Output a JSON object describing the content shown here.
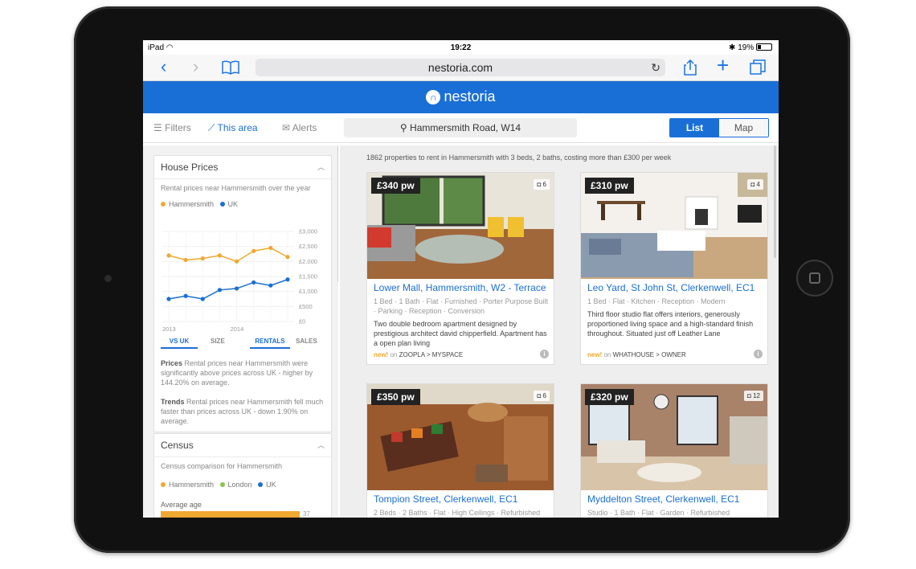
{
  "status_bar": {
    "carrier": "iPad",
    "time": "19:22",
    "battery": "19%"
  },
  "browser": {
    "url": "nestoria.com"
  },
  "site": {
    "logo_text": "nestoria",
    "brand_color": "#1a6fd6"
  },
  "toolbar": {
    "filters": "Filters",
    "this_area": "This area",
    "alerts": "Alerts",
    "search_value": "Hammersmith Road, W14",
    "list": "List",
    "map": "Map"
  },
  "sidebar": {
    "house_prices": {
      "title": "House Prices",
      "subtitle": "Rental prices near Hammersmith over the year",
      "legend": [
        "Hammersmith",
        "UK"
      ],
      "tabs": [
        "VS UK",
        "SIZE",
        "RENTALS",
        "SALES"
      ],
      "prices_label": "Prices",
      "prices_text": "Rental prices near Hammersmith were significantly above prices across UK - higher by 144.20% on average.",
      "trends_label": "Trends",
      "trends_text": "Rental prices near Hammersmith fell much faster than prices across UK - down 1.90% on average."
    },
    "census": {
      "title": "Census",
      "subtitle": "Census comparison for Hammersmith",
      "legend": [
        "Hammersmith",
        "London",
        "UK"
      ],
      "average_age_label": "Average age",
      "average_age_value": "37"
    }
  },
  "chart_data": {
    "type": "line",
    "x": [
      "2013-Q1",
      "2013-Q2",
      "2013-Q3",
      "2013-Q4",
      "2014-Q1",
      "2014-Q2",
      "2014-Q3",
      "2014-Q4"
    ],
    "xticks": [
      "2013",
      "2014"
    ],
    "series": [
      {
        "name": "Hammersmith",
        "color": "#f0a830",
        "values": [
          2200,
          2050,
          2100,
          2200,
          2000,
          2350,
          2450,
          2150
        ]
      },
      {
        "name": "UK",
        "color": "#1a6fd6",
        "values": [
          750,
          850,
          750,
          1050,
          1100,
          1300,
          1200,
          1400
        ]
      }
    ],
    "yticks": [
      "£3,000",
      "£2,500",
      "£2,000",
      "£1,500",
      "£1,000",
      "£500",
      "£0"
    ],
    "ylim": [
      0,
      3000
    ],
    "grid": true
  },
  "results": {
    "summary": "1862 properties to rent in Hammersmith with 3 beds, 2 baths, costing more than £300 per week",
    "listings": [
      {
        "price": "£340 pw",
        "photos": "6",
        "title": "Lower Mall, Hammersmith, W2 - Terrace",
        "tags": "1 Bed · 1 Bath · Flat · Furnished · Porter Purpose Built · Parking · Reception · Conversion",
        "description": "Two double bedroom apartment designed by prestigious architect david chipperfield. Apartment has a open plan living",
        "new": "new!",
        "on": "on",
        "source": "ZOOPLA > MYSPACE"
      },
      {
        "price": "£310 pw",
        "photos": "4",
        "title": "Leo Yard, St John St, Clerkenwell, EC1",
        "tags": "1 Bed · Flat · Kitchen · Reception · Modern",
        "description": "Third floor studio flat offers interiors, generously proportioned living space and a high-standard finish throughout. Situated just off Leather Lane",
        "new": "new!",
        "on": "on",
        "source": "WHATHOUSE > OWNER"
      },
      {
        "price": "£350 pw",
        "photos": "6",
        "title": "Tompion Street, Clerkenwell, EC1",
        "tags": "2 Beds · 2 Baths · Flat · High Ceilings · Refurbished",
        "description": "",
        "new": "",
        "on": "",
        "source": ""
      },
      {
        "price": "£320 pw",
        "photos": "12",
        "title": "Myddelton Street, Clerkenwell, EC1",
        "tags": "Studio · 1 Bath · Flat · Garden · Refurbished",
        "description": "",
        "new": "",
        "on": "",
        "source": ""
      }
    ]
  }
}
